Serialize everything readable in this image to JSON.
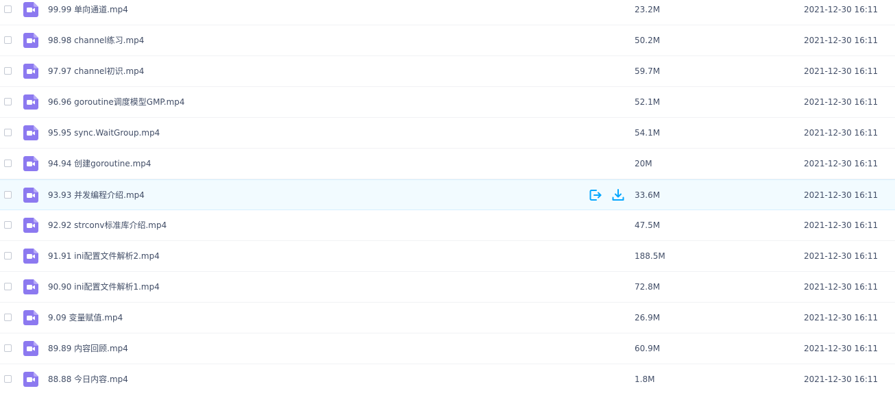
{
  "colors": {
    "icon_purple": "#8c79f0",
    "action_blue": "#06a7ff",
    "hover_bg": "#f2fbff",
    "text": "#424e67"
  },
  "icons": {
    "file": "video-file-icon",
    "share": "share-icon",
    "download": "download-icon"
  },
  "files": [
    {
      "name": "99.99 单向通道.mp4",
      "size": "23.2M",
      "modified": "2021-12-30 16:11"
    },
    {
      "name": "98.98 channel练习.mp4",
      "size": "50.2M",
      "modified": "2021-12-30 16:11"
    },
    {
      "name": "97.97 channel初识.mp4",
      "size": "59.7M",
      "modified": "2021-12-30 16:11"
    },
    {
      "name": "96.96 goroutine调度模型GMP.mp4",
      "size": "52.1M",
      "modified": "2021-12-30 16:11"
    },
    {
      "name": "95.95 sync.WaitGroup.mp4",
      "size": "54.1M",
      "modified": "2021-12-30 16:11"
    },
    {
      "name": "94.94 创建goroutine.mp4",
      "size": "20M",
      "modified": "2021-12-30 16:11"
    },
    {
      "name": "93.93 并发编程介绍.mp4",
      "size": "33.6M",
      "modified": "2021-12-30 16:11",
      "hovered": true
    },
    {
      "name": "92.92 strconv标准库介绍.mp4",
      "size": "47.5M",
      "modified": "2021-12-30 16:11"
    },
    {
      "name": "91.91 ini配置文件解析2.mp4",
      "size": "188.5M",
      "modified": "2021-12-30 16:11"
    },
    {
      "name": "90.90 ini配置文件解析1.mp4",
      "size": "72.8M",
      "modified": "2021-12-30 16:11"
    },
    {
      "name": "9.09 变量赋值.mp4",
      "size": "26.9M",
      "modified": "2021-12-30 16:11"
    },
    {
      "name": "89.89 内容回顾.mp4",
      "size": "60.9M",
      "modified": "2021-12-30 16:11"
    },
    {
      "name": "88.88 今日内容.mp4",
      "size": "1.8M",
      "modified": "2021-12-30 16:11"
    }
  ]
}
